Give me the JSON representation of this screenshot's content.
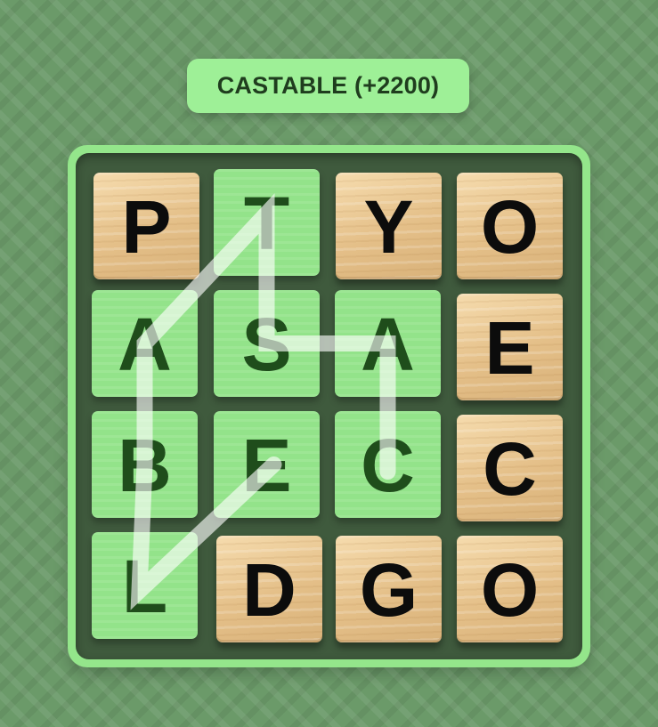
{
  "word_banner": {
    "text": "CASTABLE (+2200)"
  },
  "colors": {
    "selected_tile": "#93e38a",
    "wood_tile": "#ebc994",
    "path_stroke": "#ffffff",
    "board_border": "#94e68b",
    "board_inner": "#3f5a3d"
  },
  "grid": {
    "rows": [
      [
        {
          "letter": "P",
          "selected": false
        },
        {
          "letter": "T",
          "selected": true
        },
        {
          "letter": "Y",
          "selected": false
        },
        {
          "letter": "O",
          "selected": false
        }
      ],
      [
        {
          "letter": "A",
          "selected": true
        },
        {
          "letter": "S",
          "selected": true
        },
        {
          "letter": "A",
          "selected": true
        },
        {
          "letter": "E",
          "selected": false
        }
      ],
      [
        {
          "letter": "B",
          "selected": true
        },
        {
          "letter": "E",
          "selected": true
        },
        {
          "letter": "C",
          "selected": true
        },
        {
          "letter": "C",
          "selected": false
        }
      ],
      [
        {
          "letter": "L",
          "selected": true
        },
        {
          "letter": "D",
          "selected": false
        },
        {
          "letter": "G",
          "selected": false
        },
        {
          "letter": "O",
          "selected": false
        }
      ]
    ]
  },
  "word_path": [
    {
      "row": 2,
      "col": 2
    },
    {
      "row": 1,
      "col": 2
    },
    {
      "row": 1,
      "col": 1
    },
    {
      "row": 0,
      "col": 1
    },
    {
      "row": 1,
      "col": 0
    },
    {
      "row": 2,
      "col": 0
    },
    {
      "row": 3,
      "col": 0
    },
    {
      "row": 2,
      "col": 1
    }
  ]
}
